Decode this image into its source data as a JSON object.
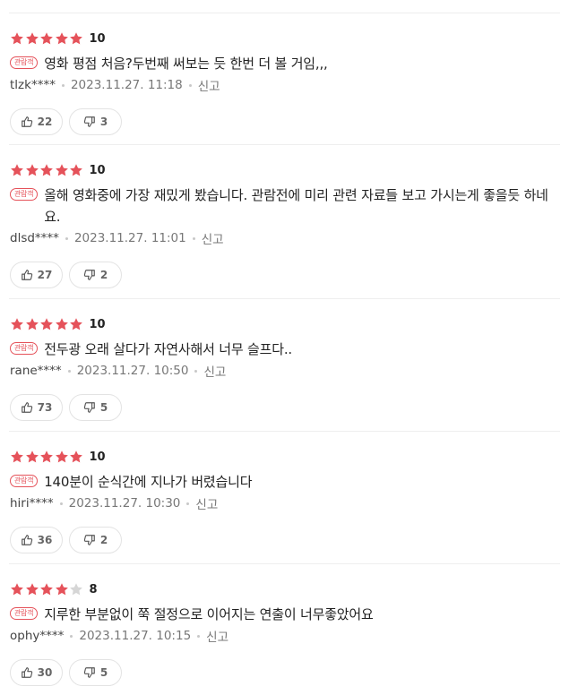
{
  "colors": {
    "star_on": "#e5525a",
    "star_off": "#d6d6d6",
    "badge": "#e5525a"
  },
  "reviews": [
    {
      "stars": 5,
      "score": "10",
      "badge": "관람객",
      "text": "영화 평점 처음?두번째 써보는 듯 한번 더 볼 거임,,,",
      "author": "tlzk****",
      "date": "2023.11.27. 11:18",
      "report": "신고",
      "likes": "22",
      "dislikes": "3"
    },
    {
      "stars": 5,
      "score": "10",
      "badge": "관람객",
      "text": "올해 영화중에 가장 재밌게 봤습니다. 관람전에 미리 관련 자료들 보고 가시는게 좋을듯 하네요.",
      "author": "dlsd****",
      "date": "2023.11.27. 11:01",
      "report": "신고",
      "likes": "27",
      "dislikes": "2"
    },
    {
      "stars": 5,
      "score": "10",
      "badge": "관람객",
      "text": "전두광 오래 살다가 자연사해서 너무 슬프다..",
      "author": "rane****",
      "date": "2023.11.27. 10:50",
      "report": "신고",
      "likes": "73",
      "dislikes": "5"
    },
    {
      "stars": 5,
      "score": "10",
      "badge": "관람객",
      "text": "140분이 순식간에 지나가 버렸습니다",
      "author": "hiri****",
      "date": "2023.11.27. 10:30",
      "report": "신고",
      "likes": "36",
      "dislikes": "2"
    },
    {
      "stars": 4,
      "score": "8",
      "badge": "관람객",
      "text": "지루한 부분없이 쭉 절정으로 이어지는 연출이 너무좋았어요",
      "author": "ophy****",
      "date": "2023.11.27. 10:15",
      "report": "신고",
      "likes": "30",
      "dislikes": "5"
    }
  ]
}
